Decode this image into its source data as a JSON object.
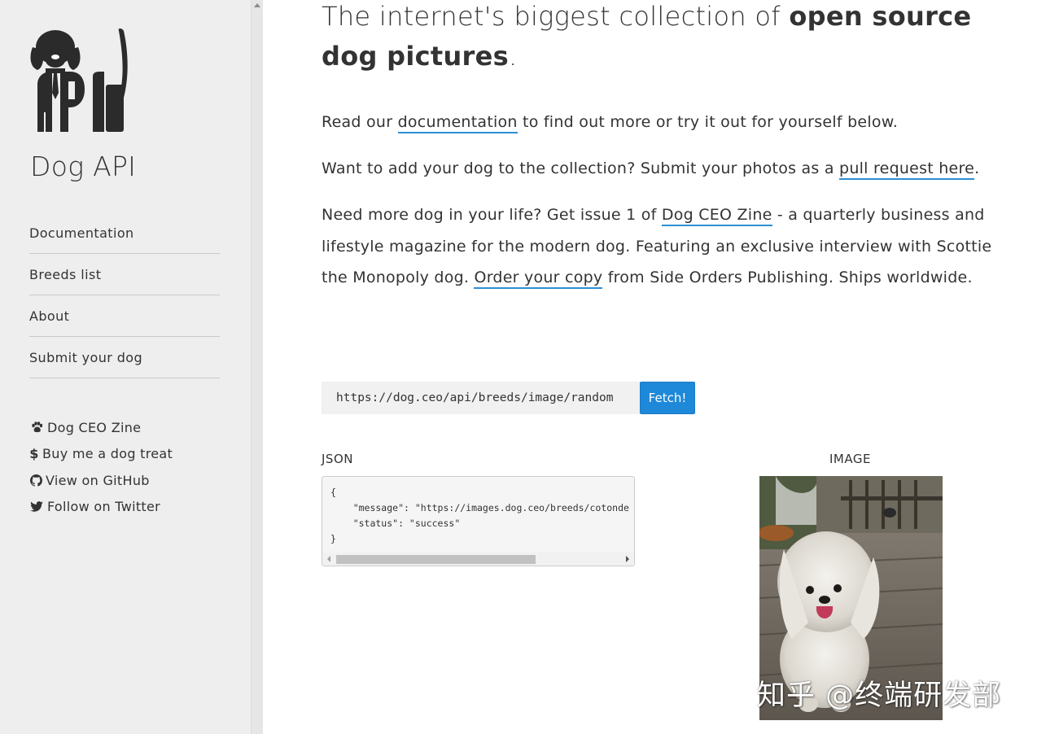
{
  "sidebar": {
    "title": "Dog API",
    "nav": [
      {
        "label": "Documentation"
      },
      {
        "label": "Breeds list"
      },
      {
        "label": "About"
      },
      {
        "label": "Submit your dog"
      }
    ],
    "extras": [
      {
        "icon": "paw-icon",
        "label": "Dog CEO Zine"
      },
      {
        "icon": "dollar-icon",
        "label": "Buy me a dog treat"
      },
      {
        "icon": "github-icon",
        "label": "View on GitHub"
      },
      {
        "icon": "twitter-icon",
        "label": "Follow on Twitter"
      }
    ]
  },
  "main": {
    "headline_prefix": "The internet's biggest collection of ",
    "headline_bold": "open source dog pictures",
    "headline_suffix": ".",
    "para1": {
      "before": "Read our ",
      "link": "documentation",
      "after": " to find out more or try it out for yourself below."
    },
    "para2": {
      "before": "Want to add your dog to the collection? Submit your photos as a ",
      "link": "pull request here",
      "after": "."
    },
    "para3": {
      "before": "Need more dog in your life? Get issue 1 of ",
      "link1": "Dog CEO Zine",
      "middle": " - a quarterly business and lifestyle magazine for the modern dog. Featuring an exclusive interview with Scottie the Monopoly dog. ",
      "link2": "Order your copy",
      "after": " from Side Orders Publishing. Ships worldwide."
    }
  },
  "fetch": {
    "url": "https://dog.ceo/api/breeds/image/random",
    "button_label": "Fetch!"
  },
  "results": {
    "json_label": "JSON",
    "image_label": "IMAGE",
    "json_text": "{\n    \"message\": \"https://images.dog.ceo/breeds/cotonde\n    \"status\": \"success\"\n}"
  },
  "watermark": "知乎 @终端研发部",
  "colors": {
    "sidebar_bg": "#eeeeee",
    "accent": "#1e88d9",
    "link_underline": "#2d8fd5",
    "text": "#333333"
  }
}
